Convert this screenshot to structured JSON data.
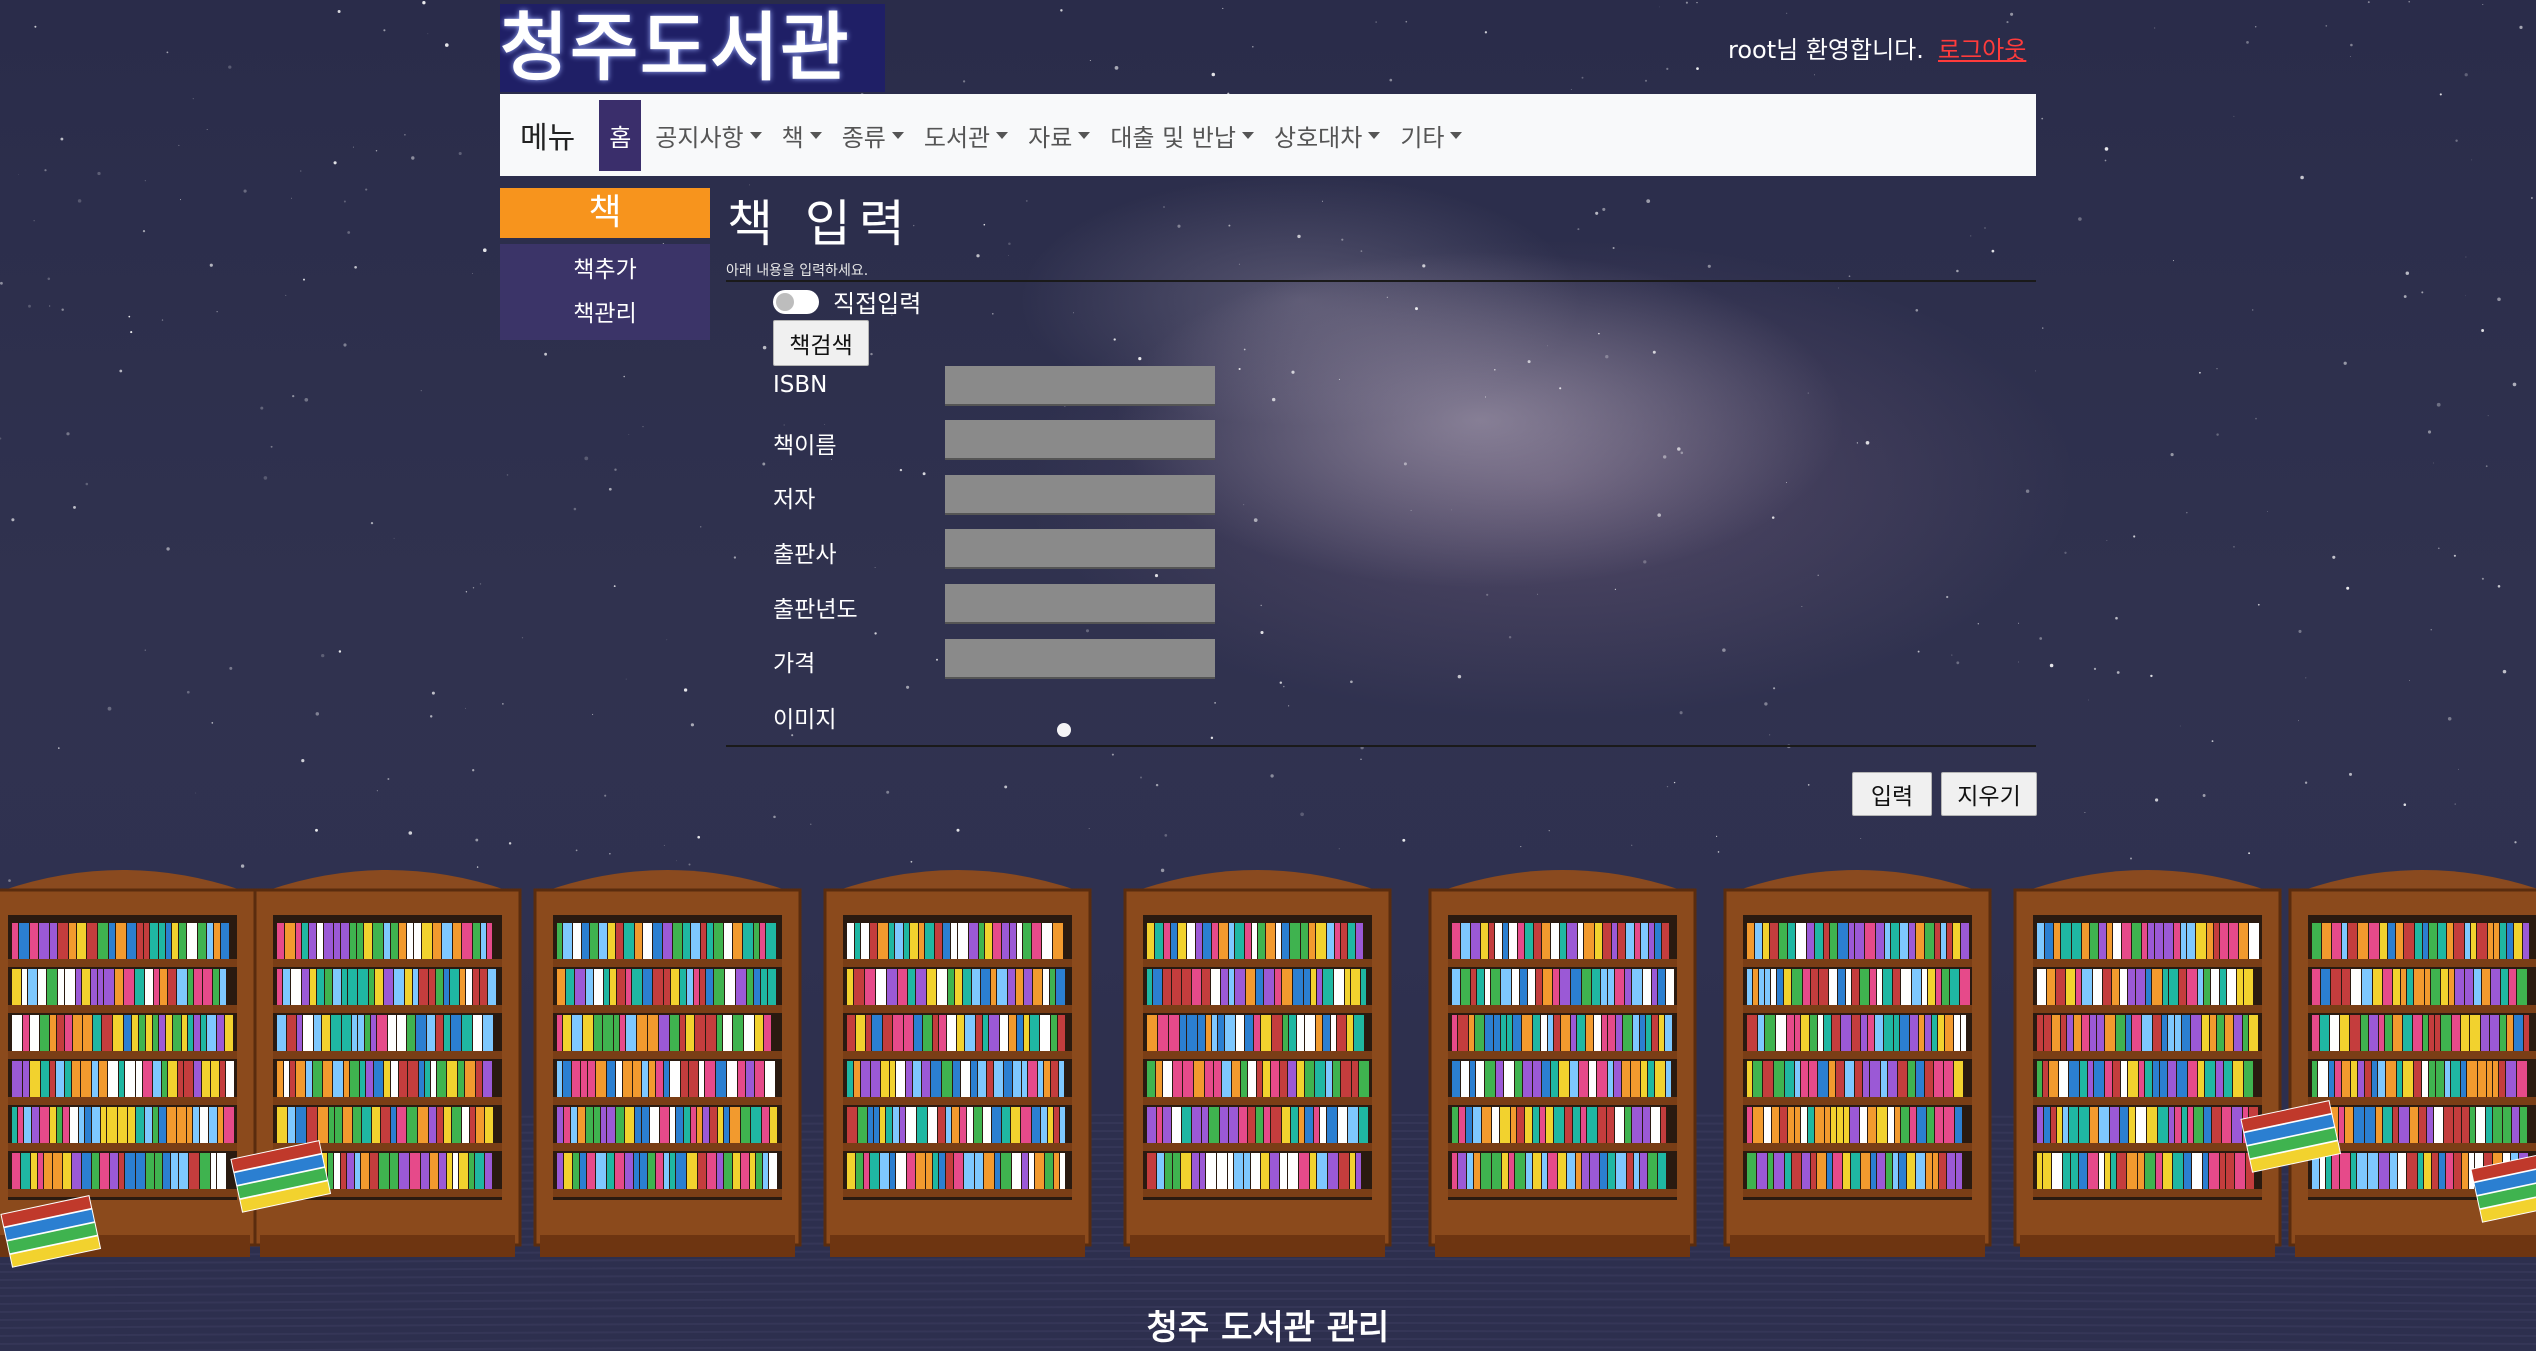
{
  "header": {
    "logo_text": "청주도서관",
    "welcome": "root님 환영합니다.",
    "logout": "로그아웃"
  },
  "nav": {
    "brand": "메뉴",
    "home": "홈",
    "items": [
      "공지사항",
      "책",
      "종류",
      "도서관",
      "자료",
      "대출 및 반납",
      "상호대차",
      "기타"
    ]
  },
  "sidebar": {
    "title": "책",
    "links": [
      "책추가",
      "책관리"
    ]
  },
  "form": {
    "title": "책 입력",
    "subtitle": "아래 내용을 입력하세요.",
    "toggle_label": "직접입력",
    "search_button": "책검색",
    "fields": [
      {
        "label": "ISBN",
        "value": ""
      },
      {
        "label": "책이름",
        "value": ""
      },
      {
        "label": "저자",
        "value": ""
      },
      {
        "label": "출판사",
        "value": ""
      },
      {
        "label": "출판년도",
        "value": ""
      },
      {
        "label": "가격",
        "value": ""
      }
    ],
    "image_label": "이미지",
    "submit": "입력",
    "clear": "지우기"
  },
  "footer": "청주 도서관 관리",
  "colors": {
    "accent_orange": "#f7941d",
    "nav_active": "#3a2e6b",
    "logout_red": "#ff3b3b",
    "input_gray": "#8a8a8a"
  }
}
